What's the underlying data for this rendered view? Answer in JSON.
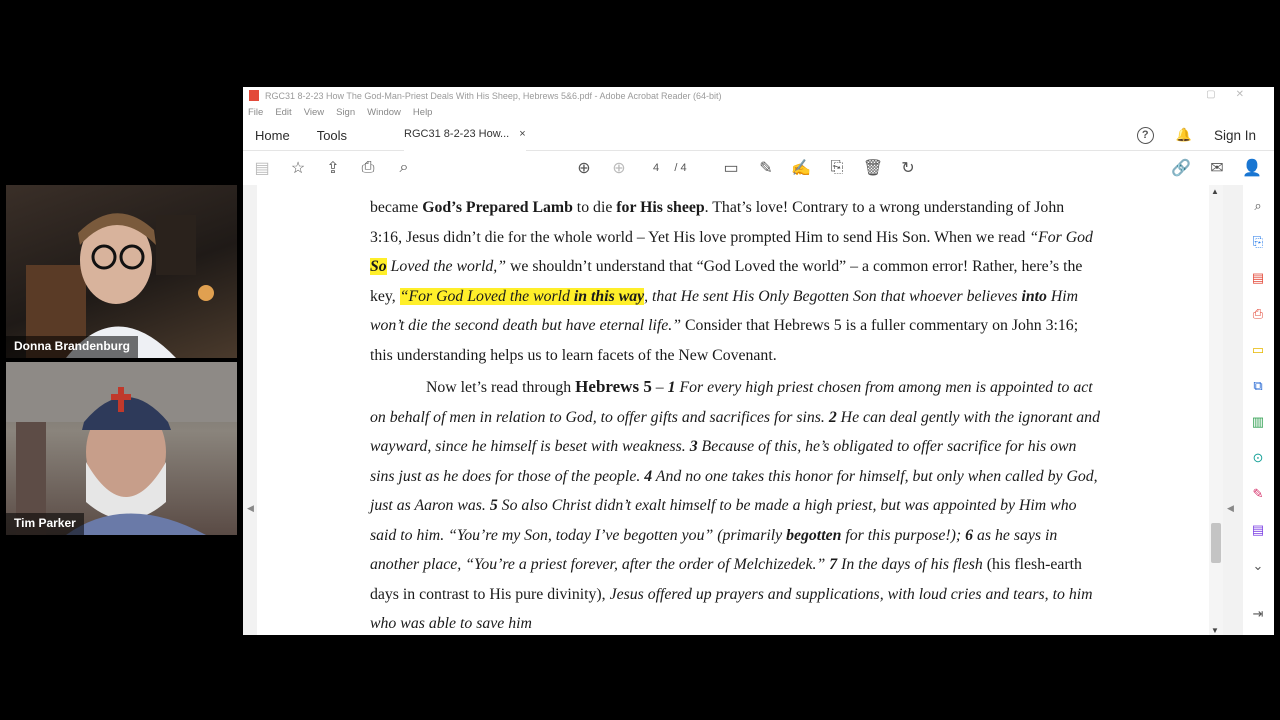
{
  "participants": [
    {
      "name": "Donna Brandenburg"
    },
    {
      "name": "Tim Parker"
    }
  ],
  "window": {
    "title": "RGC31 8-2-23 How The God-Man-Priest Deals With His Sheep, Hebrews 5&6.pdf - Adobe Acrobat Reader (64-bit)"
  },
  "menu": [
    "File",
    "Edit",
    "View",
    "Sign",
    "Window",
    "Help"
  ],
  "tabs": {
    "home": "Home",
    "tools": "Tools",
    "doc": "RGC31 8-2-23 How...",
    "close": "×",
    "sign_in": "Sign In"
  },
  "toolbar": {
    "page_current": "4",
    "page_total": "/ 4"
  },
  "icons": {
    "toolbar": [
      "save-icon",
      "star-icon",
      "upload-icon",
      "print-icon",
      "zoom-icon",
      "page-up-icon",
      "page-down-icon",
      "comment-icon",
      "pen-icon",
      "sign-icon",
      "stamp-icon",
      "delete-icon",
      "rotate-icon",
      "link-icon",
      "mail-icon",
      "share-user-icon"
    ],
    "right_panel": [
      "search-panel-icon",
      "export-pdf-icon",
      "organize-icon",
      "edit-pdf-icon",
      "comment-panel-icon",
      "combine-icon",
      "fill-sign-icon",
      "protect-icon",
      "scan-icon",
      "create-pdf-icon",
      "more-icon"
    ]
  },
  "document": {
    "p1": {
      "s1": "became ",
      "s2": "God’s Prepared Lamb",
      "s3": " to die ",
      "s4": "for His sheep",
      "s5": ". That’s love! Contrary to a wrong understanding of John 3:16, Jesus didn’t die for the whole world – Yet His love prompted Him to send His Son. When we read ",
      "s6": "“For God ",
      "s7": "So",
      "s8": " Loved the world,”",
      "s9": " we shouldn’t understand that “God Loved the world” – a common error! Rather, here’s the key, ",
      "s10": "“For God Loved the world ",
      "s11": "in this way",
      "s12": ", that He sent His Only Begotten Son that whoever believes ",
      "s13": "into",
      "s14": " Him won’t die the second death but have eternal life.”",
      "s15": " Consider that Hebrews 5 is a fuller commentary on John 3:16; this understanding helps us to learn facets of the New Covenant."
    },
    "p2": {
      "s1": "Now let’s read through ",
      "s2": "Hebrews 5",
      "s3": " – ",
      "v1": "1",
      "s4": " For every high priest chosen from among men is appointed to act on behalf of men in relation to God, to offer gifts and sacrifices for sins. ",
      "v2": "2",
      "s5": " He can deal gently with the ignorant and wayward, since he himself is beset with weakness. ",
      "v3": "3",
      "s6": " Because of this, he’s obligated to offer sacrifice for his own sins just as he does for those of the people. ",
      "v4": "4",
      "s7": " And no one takes this honor for himself, but only when called by God, just as Aaron was. ",
      "v5": "5",
      "s8": " So also Christ didn’t exalt himself to be made a high priest, but was appointed by Him who said to him. “You’re my Son, today I’ve begotten you” ",
      "s9": "(primarily ",
      "s10": "begotten",
      "s11": " for this purpose!); ",
      "v6": "6",
      "s12": " as he says in another place, “You’re a priest forever, after the order of Melchizedek.” ",
      "v7": "7",
      "s13": " In the days of his flesh",
      "s14": " (his flesh-earth days in contrast to His pure divinity), ",
      "s15": "Jesus offered up prayers and supplications, with loud cries and tears, to him who was able to save him"
    }
  },
  "colors": {
    "highlight": "#ffef2a",
    "adobe_red": "#e34a3a"
  }
}
